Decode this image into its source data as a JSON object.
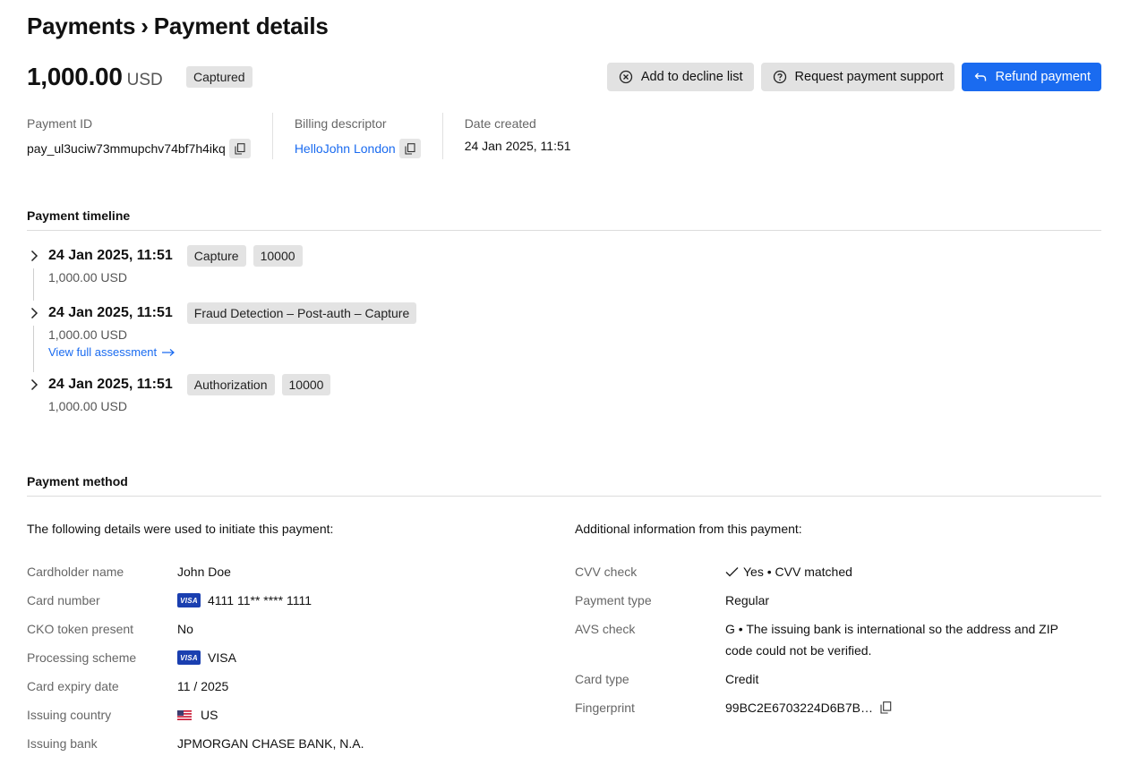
{
  "breadcrumb": {
    "parent": "Payments",
    "separator": "›",
    "current": "Payment details"
  },
  "payment": {
    "amount": "1,000.00",
    "currency": "USD",
    "status": "Captured"
  },
  "actions": {
    "decline": "Add to decline list",
    "support": "Request payment support",
    "refund": "Refund payment"
  },
  "meta": {
    "payment_id_label": "Payment ID",
    "payment_id": "pay_ul3uciw73mmupchv74bf7h4ikq",
    "billing_label": "Billing descriptor",
    "billing": "HelloJohn London",
    "date_label": "Date created",
    "date": "24 Jan 2025, 11:51"
  },
  "timeline": {
    "title": "Payment timeline",
    "items": [
      {
        "date": "24 Jan 2025, 11:51",
        "badges": [
          "Capture",
          "10000"
        ],
        "amount": "1,000.00 USD"
      },
      {
        "date": "24 Jan 2025, 11:51",
        "badges": [
          "Fraud Detection – Post-auth – Capture"
        ],
        "amount": "1,000.00 USD",
        "link": "View full assessment"
      },
      {
        "date": "24 Jan 2025, 11:51",
        "badges": [
          "Authorization",
          "10000"
        ],
        "amount": "1,000.00 USD"
      }
    ]
  },
  "method": {
    "title": "Payment method",
    "left_intro": "The following details were used to initiate this payment:",
    "right_intro": "Additional information from this payment:",
    "left": [
      {
        "label": "Cardholder name",
        "value": "John Doe"
      },
      {
        "label": "Card number",
        "value": "4111 11** **** 1111",
        "icon": "visa"
      },
      {
        "label": "CKO token present",
        "value": "No"
      },
      {
        "label": "Processing scheme",
        "value": "VISA",
        "icon": "visa"
      },
      {
        "label": "Card expiry date",
        "value": "11 / 2025"
      },
      {
        "label": "Issuing country",
        "value": "US",
        "icon": "us-flag"
      },
      {
        "label": "Issuing bank",
        "value": "JPMORGAN CHASE BANK, N.A."
      }
    ],
    "right": [
      {
        "label": "CVV check",
        "value": "Yes • CVV matched",
        "icon": "check-icon"
      },
      {
        "label": "Payment type",
        "value": "Regular"
      },
      {
        "label": "AVS check",
        "value_line1": "G • The issuing bank is international so the address and ZIP",
        "value_line2": "code could not be verified."
      },
      {
        "label": "Card type",
        "value": "Credit"
      },
      {
        "label": "Fingerprint",
        "value": "99BC2E6703224D6B7B…",
        "icon": "copy-icon"
      }
    ]
  },
  "visa_text": "VISA",
  "colors": {
    "accent": "#1a6bf0",
    "badge_bg": "#e3e3e3",
    "visa_blue": "#1a3fb0"
  }
}
